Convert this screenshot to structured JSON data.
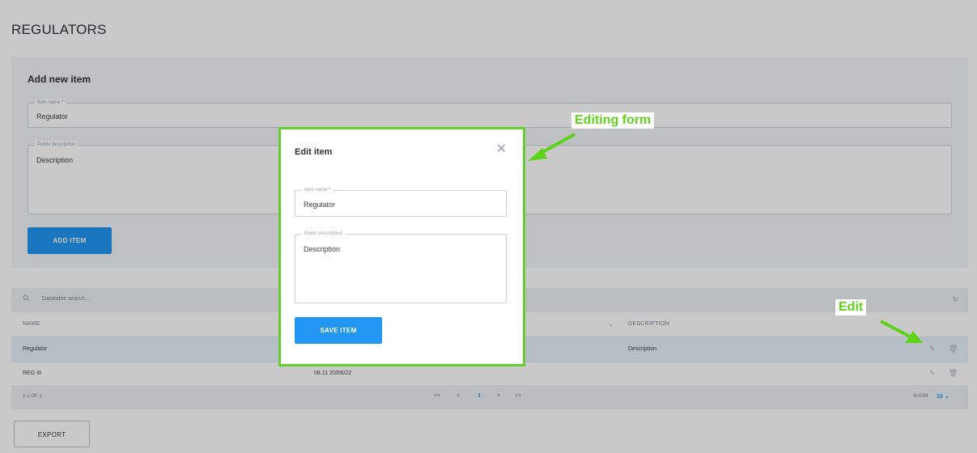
{
  "page": {
    "title": "REGULATORS"
  },
  "add_form": {
    "title": "Add new item",
    "name_label": "Item name",
    "required_mark": "*",
    "name_value": "Regulator",
    "description_label": "Public description",
    "description_value": "Description",
    "add_button": "ADD ITEM"
  },
  "table": {
    "search_placeholder": "Datatable search...",
    "columns": [
      "NAME",
      "DESCRIPTION"
    ],
    "rows": [
      {
        "name": "Regulator",
        "date": "",
        "description": "Description"
      },
      {
        "name": "REG III",
        "date": "08.11 20/06/22",
        "description": ""
      }
    ],
    "footer": {
      "range": "1-1 OF 1",
      "pagination": {
        "first": "<<",
        "prev": "<",
        "current": "1",
        "next": ">",
        "last": ">>"
      },
      "show_label": "SHOW",
      "show_value": "10"
    },
    "export_button": "EXPORT"
  },
  "modal": {
    "title": "Edit item",
    "name_label": "Item name",
    "required_mark": "*",
    "name_value": "Regulator",
    "description_label": "Public description",
    "description_value": "Description",
    "save_button": "SAVE ITEM"
  },
  "annotations": {
    "editing_form": "Editing form",
    "edit": "Edit"
  },
  "icons": {
    "close": "close-icon",
    "search": "search-icon",
    "refresh": "refresh-icon",
    "edit": "pencil-icon",
    "delete": "trash-icon",
    "sort": "sort-down-icon"
  },
  "colors": {
    "accent": "#2196f3",
    "annotation": "#5fd31b",
    "modal_border": "#66cc33",
    "required": "#e53935"
  }
}
